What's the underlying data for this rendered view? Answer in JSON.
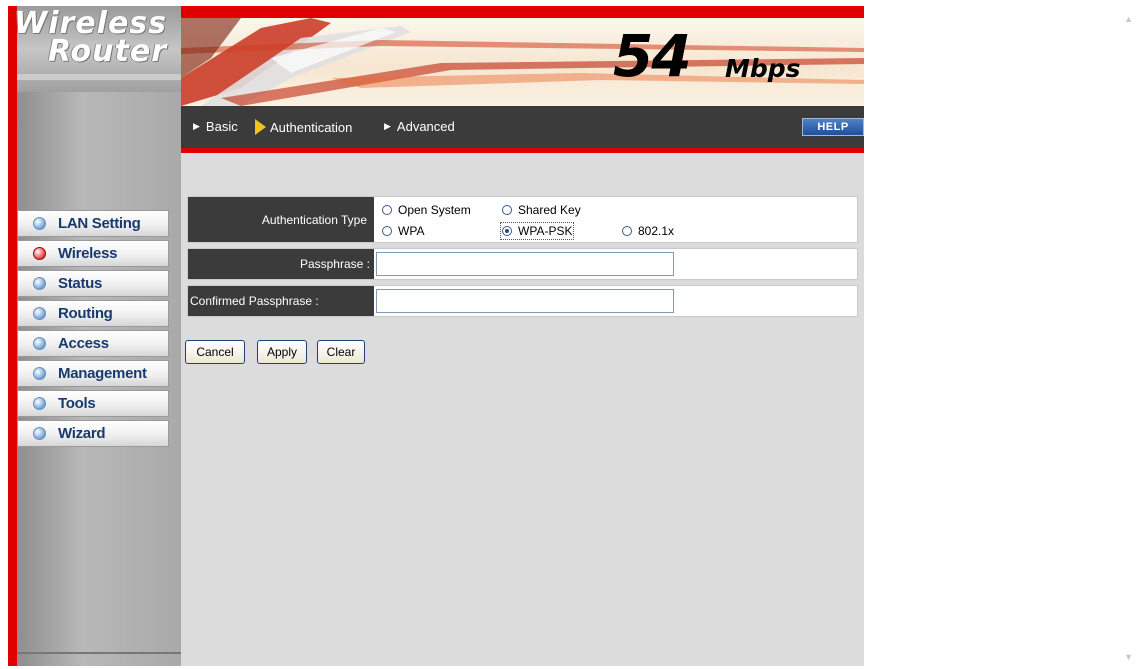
{
  "logo": {
    "line1": "Wireless",
    "line2": "Router"
  },
  "nav": {
    "items": [
      {
        "label": "LAN Setting",
        "active": false
      },
      {
        "label": "Wireless",
        "active": true
      },
      {
        "label": "Status",
        "active": false
      },
      {
        "label": "Routing",
        "active": false
      },
      {
        "label": "Access",
        "active": false
      },
      {
        "label": "Management",
        "active": false
      },
      {
        "label": "Tools",
        "active": false
      },
      {
        "label": "Wizard",
        "active": false
      }
    ]
  },
  "banner": {
    "speed_number": "54",
    "speed_unit": "Mbps"
  },
  "tabs": [
    {
      "label": "Basic",
      "active": false
    },
    {
      "label": "Authentication",
      "active": true
    },
    {
      "label": "Advanced",
      "active": false
    }
  ],
  "help_label": "HELP",
  "form": {
    "auth_type_label": "Authentication Type",
    "options": [
      {
        "label": "Open System",
        "checked": false
      },
      {
        "label": "Shared Key",
        "checked": false
      },
      {
        "label": "WPA",
        "checked": false
      },
      {
        "label": "WPA-PSK",
        "checked": true
      },
      {
        "label": "802.1x",
        "checked": false
      }
    ],
    "passphrase_label": "Passphrase :",
    "passphrase_value": "",
    "confirmed_label": "Confirmed Passphrase :",
    "confirmed_value": ""
  },
  "buttons": {
    "cancel": "Cancel",
    "apply": "Apply",
    "clear": "Clear"
  },
  "colors": {
    "brand_red": "#e00000",
    "bar_dark": "#3b3b3b",
    "panel_gray": "#dcdcdc"
  }
}
